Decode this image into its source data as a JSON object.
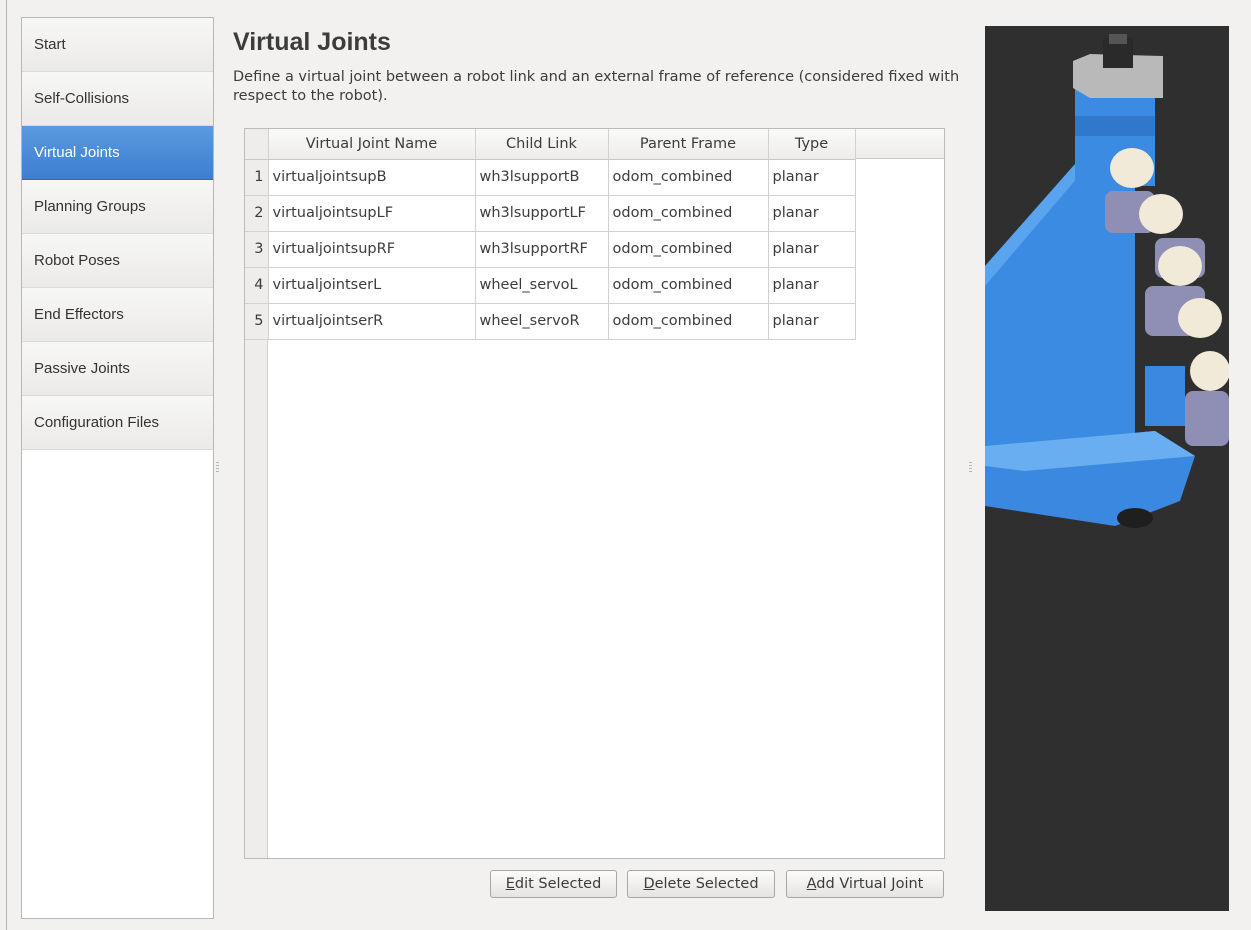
{
  "sidebar": {
    "items": [
      {
        "label": "Start"
      },
      {
        "label": "Self-Collisions"
      },
      {
        "label": "Virtual Joints"
      },
      {
        "label": "Planning Groups"
      },
      {
        "label": "Robot Poses"
      },
      {
        "label": "End Effectors"
      },
      {
        "label": "Passive Joints"
      },
      {
        "label": "Configuration Files"
      }
    ],
    "active_index": 2
  },
  "header": {
    "title": "Virtual Joints",
    "description": "Define a virtual joint between a robot link and an external frame of reference (considered fixed with respect to the robot)."
  },
  "table": {
    "columns": [
      "Virtual Joint Name",
      "Child Link",
      "Parent Frame",
      "Type"
    ],
    "rows": [
      {
        "num": "1",
        "name": "virtualjointsupB",
        "child": "wh3lsupportB",
        "parent": "odom_combined",
        "type": "planar"
      },
      {
        "num": "2",
        "name": "virtualjointsupLF",
        "child": "wh3lsupportLF",
        "parent": "odom_combined",
        "type": "planar"
      },
      {
        "num": "3",
        "name": "virtualjointsupRF",
        "child": "wh3lsupportRF",
        "parent": "odom_combined",
        "type": "planar"
      },
      {
        "num": "4",
        "name": "virtualjointserL",
        "child": "wheel_servoL",
        "parent": "odom_combined",
        "type": "planar"
      },
      {
        "num": "5",
        "name": "virtualjointserR",
        "child": "wheel_servoR",
        "parent": "odom_combined",
        "type": "planar"
      }
    ]
  },
  "buttons": {
    "edit_mnemonic": "E",
    "edit_rest": "dit Selected",
    "delete_mnemonic": "D",
    "delete_rest": "elete Selected",
    "add_mnemonic": "A",
    "add_rest": "dd Virtual Joint"
  },
  "colors": {
    "accent": "#4a8ad8",
    "robot_blue": "#3d8ee6",
    "viewport_bg": "#2f2f2f"
  }
}
